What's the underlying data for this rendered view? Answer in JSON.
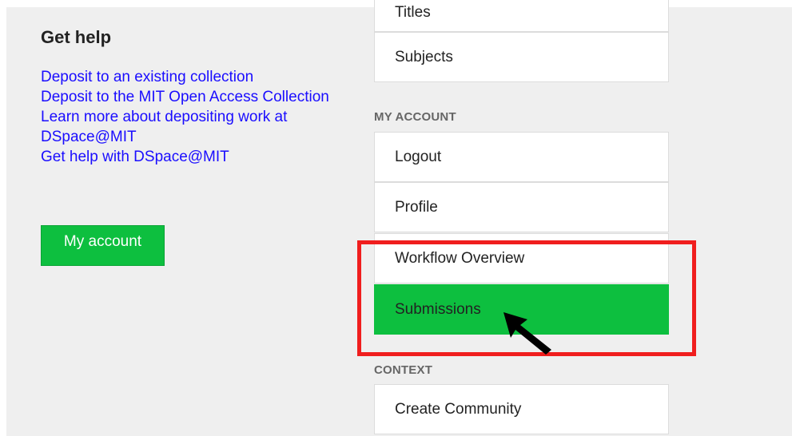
{
  "help": {
    "title": "Get help",
    "links": [
      "Deposit to an existing collection",
      "Deposit to the MIT Open Access Collection",
      "Learn more about depositing work at DSpace@MIT",
      "Get help with DSpace@MIT"
    ],
    "my_account_label": "My account"
  },
  "nav": {
    "browse_items": [
      "Titles",
      "Subjects"
    ],
    "my_account_heading": "MY ACCOUNT",
    "my_account_items": [
      "Logout",
      "Profile",
      "Workflow Overview",
      "Submissions"
    ],
    "active_item": "Submissions",
    "context_heading": "CONTEXT",
    "context_items": [
      "Create Community"
    ]
  },
  "colors": {
    "accent_green": "#0dbf3f",
    "link_blue": "#1a0dff",
    "highlight_red": "#f01e1e"
  },
  "icons": {
    "cursor": "arrow-pointer-icon"
  }
}
